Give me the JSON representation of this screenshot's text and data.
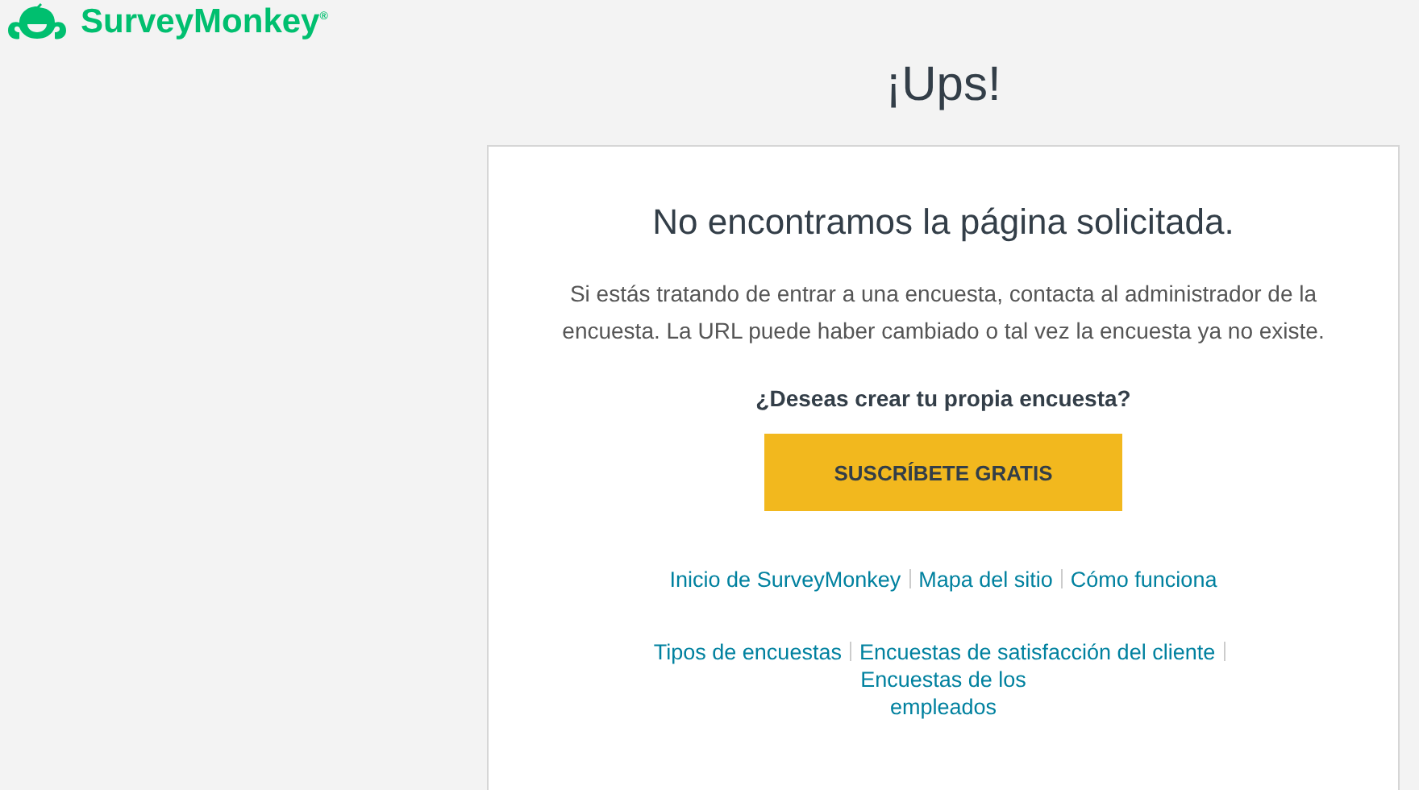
{
  "logo": {
    "text": "SurveyMonkey$^{®}$"
  },
  "title": "¡Ups!",
  "card": {
    "heading": "No encontramos la página solicitada.",
    "message": "Si estás tratando de entrar a una encuesta, contacta al administrador de la encuesta. La URL puede haber cambiado o tal vez la encuesta ya no existe.",
    "question": "¿Deseas crear tu propia encuesta?",
    "button": "SUSCRÍBETE GRATIS",
    "link_groups": [
      [
        "Inicio de SurveyMonkey",
        "Mapa del sitio",
        "Cómo funciona"
      ],
      [
        "Tipos de encuestas",
        "Encuestas de satisfacción del cliente",
        "Encuestas de los empleados"
      ]
    ]
  }
}
